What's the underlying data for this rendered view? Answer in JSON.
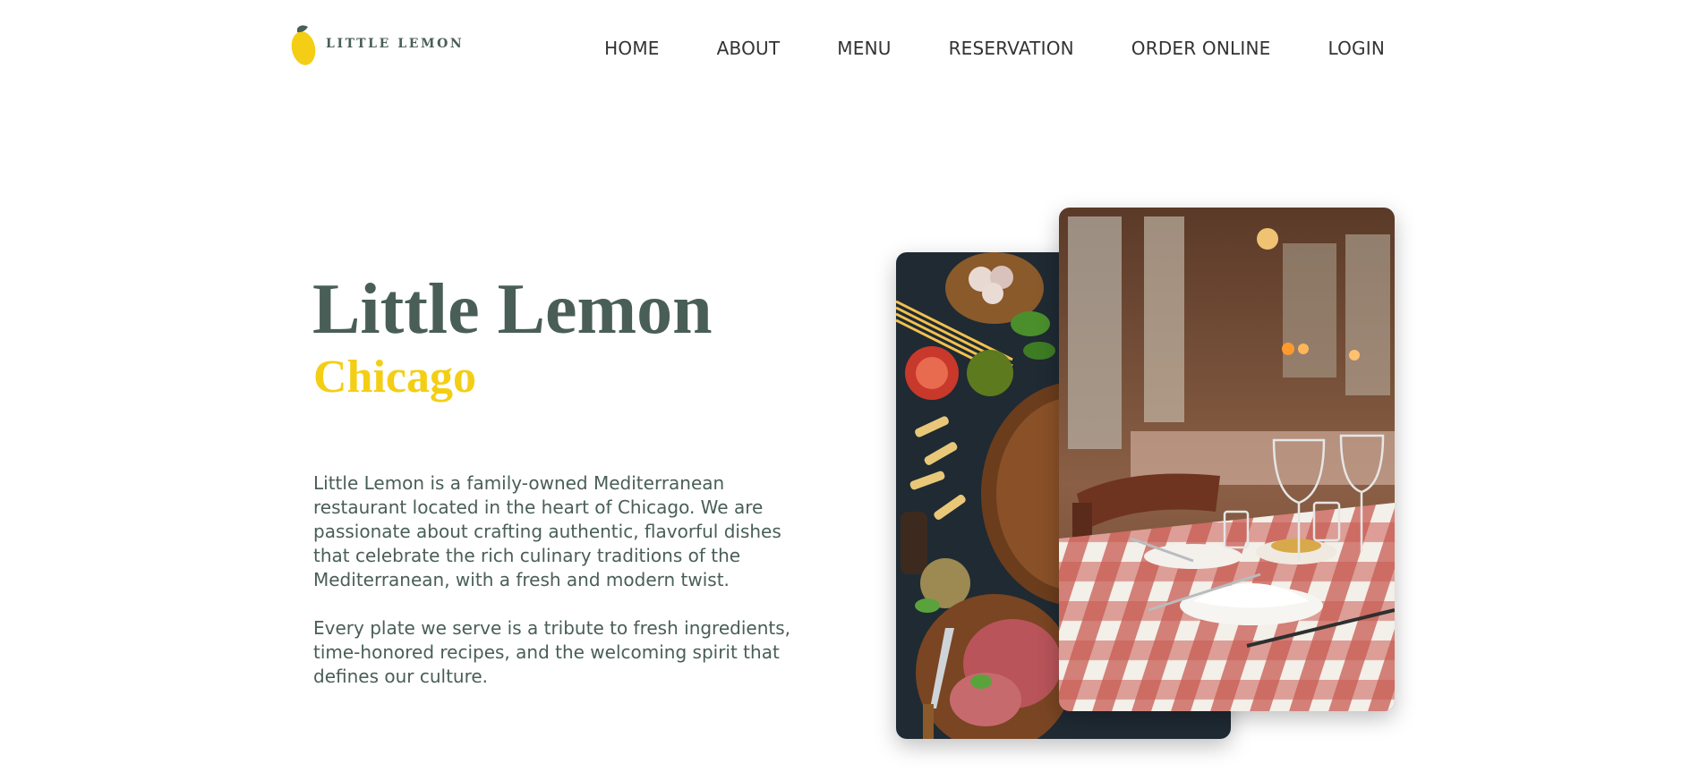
{
  "header": {
    "logo_text": "LITTLE LEMON",
    "logo_icon": "lemon-icon",
    "nav": {
      "home": "HOME",
      "about": "ABOUT",
      "menu": "MENU",
      "reservation": "RESERVATION",
      "order_online": "ORDER ONLINE",
      "login": "LOGIN"
    }
  },
  "hero": {
    "title": "Little Lemon",
    "subtitle": "Chicago",
    "paragraph_1": "Little Lemon is a family-owned Mediterranean restaurant located in the heart of Chicago. We are passionate about crafting authentic, flavorful dishes that celebrate the rich culinary traditions of the Mediterranean, with a fresh and modern twist.",
    "paragraph_2": "Every plate we serve is a tribute to fresh ingredients, time-honored recipes, and the welcoming spirit that defines our culture.",
    "images": {
      "food": "food-ingredients-photo",
      "restaurant": "restaurant-interior-photo"
    }
  },
  "colors": {
    "primary_green": "#495e57",
    "primary_yellow": "#f4ce14",
    "nav_text": "#333333",
    "background": "#ffffff"
  }
}
